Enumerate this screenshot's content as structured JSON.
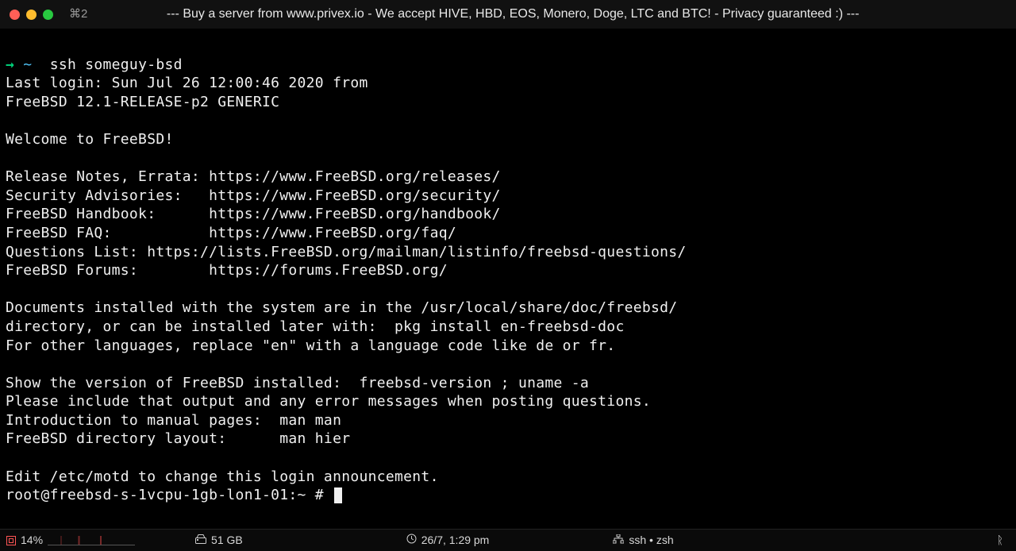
{
  "titlebar": {
    "tab_indicator": "⌘2",
    "title": "--- Buy a server from www.privex.io - We accept HIVE, HBD, EOS, Monero, Doge, LTC and BTC! - Privacy guaranteed :) ---"
  },
  "session": {
    "local_prompt_arrow": "→",
    "local_prompt_path": "~",
    "ssh_command": "ssh someguy-bsd",
    "lines": [
      "Last login: Sun Jul 26 12:00:46 2020 from",
      "FreeBSD 12.1-RELEASE-p2 GENERIC",
      "",
      "Welcome to FreeBSD!",
      "",
      "Release Notes, Errata: https://www.FreeBSD.org/releases/",
      "Security Advisories:   https://www.FreeBSD.org/security/",
      "FreeBSD Handbook:      https://www.FreeBSD.org/handbook/",
      "FreeBSD FAQ:           https://www.FreeBSD.org/faq/",
      "Questions List: https://lists.FreeBSD.org/mailman/listinfo/freebsd-questions/",
      "FreeBSD Forums:        https://forums.FreeBSD.org/",
      "",
      "Documents installed with the system are in the /usr/local/share/doc/freebsd/",
      "directory, or can be installed later with:  pkg install en-freebsd-doc",
      "For other languages, replace \"en\" with a language code like de or fr.",
      "",
      "Show the version of FreeBSD installed:  freebsd-version ; uname -a",
      "Please include that output and any error messages when posting questions.",
      "Introduction to manual pages:  man man",
      "FreeBSD directory layout:      man hier",
      "",
      "Edit /etc/motd to change this login announcement."
    ],
    "remote_prompt": "root@freebsd-s-1vcpu-1gb-lon1-01:~ # "
  },
  "status": {
    "cpu_percent": "14%",
    "disk": "51 GB",
    "datetime": "26/7, 1:29 pm",
    "proc": "ssh • zsh",
    "branch_glyph": "ᚱ"
  }
}
